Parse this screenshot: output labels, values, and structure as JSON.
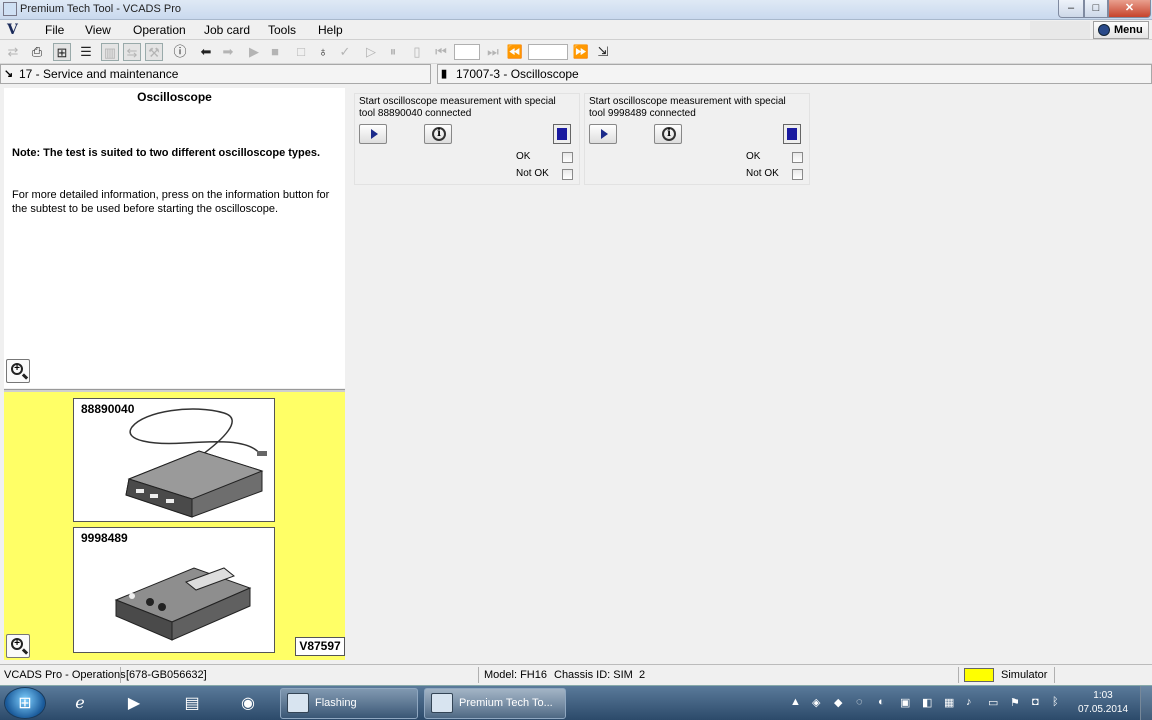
{
  "window": {
    "title": "Premium Tech Tool - VCADS Pro",
    "minimize_label": "–",
    "maximize_label": "□",
    "close_label": "✕"
  },
  "menubar": {
    "logo": "V",
    "items": [
      "File",
      "View",
      "Operation",
      "Job card",
      "Tools",
      "Help"
    ],
    "menu_button_label": "Menu"
  },
  "toolbar": {
    "icons": [
      "arrows-icon",
      "print-icon",
      "tree-icon",
      "list-icon",
      "bars-icon",
      "compare-icon",
      "wrench-icon",
      "info-icon",
      "back-arrow-icon",
      "forward-arrow-icon",
      "play-icon",
      "stop-icon",
      "blank-icon",
      "lightbulb-icon",
      "check-icon",
      "step-icon",
      "pause-icon",
      "first-icon",
      "next-icon",
      "rewind-icon",
      "fast-forward-icon",
      "export-icon"
    ]
  },
  "context": {
    "left": "17 - Service and maintenance",
    "right": "17007-3 - Oscilloscope"
  },
  "info_panel": {
    "heading": "Oscilloscope",
    "note": "Note: The test is suited to two different oscilloscope types.",
    "info": "For more detailed information, press on the information button for the subtest to be used before starting the oscilloscope."
  },
  "image_panel": {
    "tool1": "88890040",
    "tool2": "9998489",
    "reference": "V87597",
    "background_color": "#ffff66"
  },
  "subtests": [
    {
      "description": "Start oscilloscope measurement with special tool 88890040 connected",
      "ok_label": "OK",
      "not_ok_label": "Not OK"
    },
    {
      "description": "Start oscilloscope measurement with special tool 9998489 connected",
      "ok_label": "OK",
      "not_ok_label": "Not OK"
    }
  ],
  "statusbar": {
    "mode": "VCADS Pro - Operations",
    "id": "[678-GB056632]",
    "model": "Model: FH16",
    "chassis": "Chassis ID: SIM  2",
    "simulator": "Simulator",
    "simulator_color": "#ffff00"
  },
  "taskbar": {
    "items": [
      "Flashing",
      "Premium Tech To..."
    ],
    "time": "1:03",
    "date": "07.05.2014"
  }
}
